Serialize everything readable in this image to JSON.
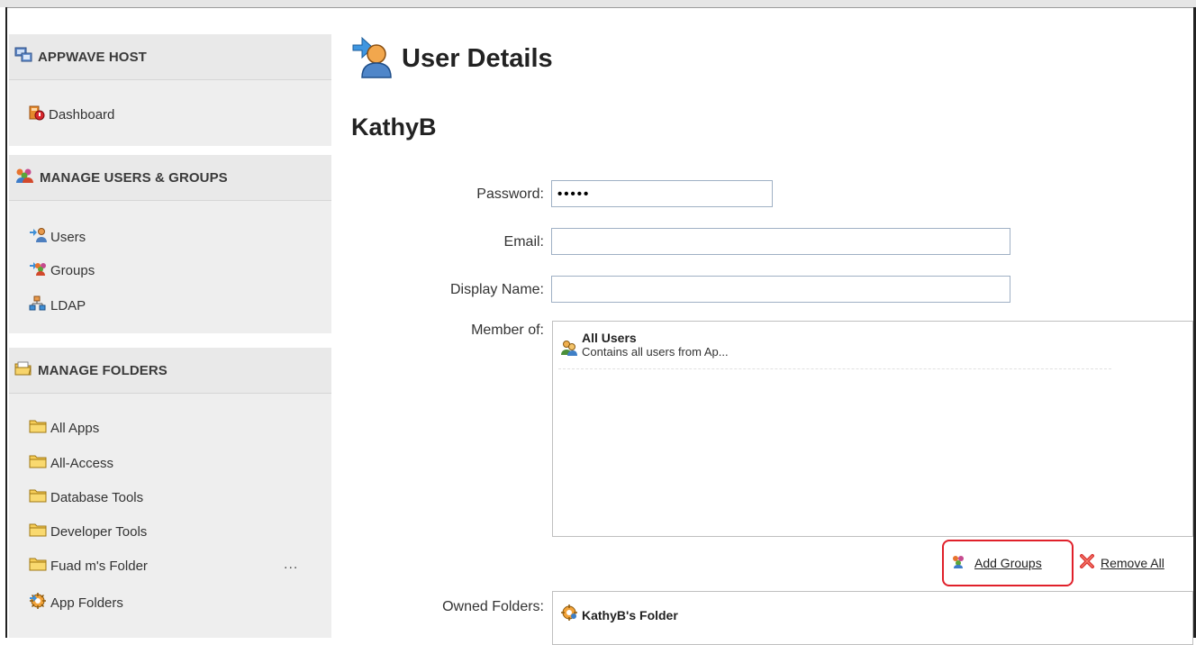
{
  "sidebar": {
    "host": {
      "title": "APPWAVE HOST",
      "icon": "appwave-host-icon",
      "items": [
        {
          "label": "Dashboard",
          "icon": "dashboard-icon"
        }
      ]
    },
    "users_groups": {
      "title": "MANAGE USERS & GROUPS",
      "icon": "users-groups-icon",
      "items": [
        {
          "label": "Users",
          "icon": "users-icon"
        },
        {
          "label": "Groups",
          "icon": "groups-icon"
        },
        {
          "label": "LDAP",
          "icon": "ldap-icon"
        }
      ]
    },
    "folders": {
      "title": "MANAGE FOLDERS",
      "icon": "manage-folders-icon",
      "items": [
        {
          "label": "All Apps",
          "icon": "folder-icon"
        },
        {
          "label": "All-Access",
          "icon": "folder-icon"
        },
        {
          "label": "Database Tools",
          "icon": "folder-icon"
        },
        {
          "label": "Developer Tools",
          "icon": "folder-icon"
        },
        {
          "label": "Fuad m's Folder",
          "icon": "folder-icon"
        },
        {
          "label": "App Folders",
          "icon": "app-folders-icon"
        }
      ],
      "more": "..."
    }
  },
  "main": {
    "title": "User Details",
    "user_name": "KathyB",
    "form": {
      "password_label": "Password:",
      "password_value": "•••••",
      "email_label": "Email:",
      "email_value": "",
      "display_name_label": "Display Name:",
      "display_name_value": "",
      "member_of_label": "Member of:",
      "owned_folders_label": "Owned Folders:"
    },
    "member_of": [
      {
        "name": "All Users",
        "description": "Contains all users from Ap..."
      }
    ],
    "actions": {
      "add_groups": "Add Groups",
      "remove_all": "Remove All"
    },
    "owned_folders": [
      {
        "name": "KathyB's Folder"
      }
    ]
  },
  "colors": {
    "highlight": "#e0202a",
    "input_border": "#9fb0c4",
    "sidebar_bg": "#eeeeee"
  }
}
